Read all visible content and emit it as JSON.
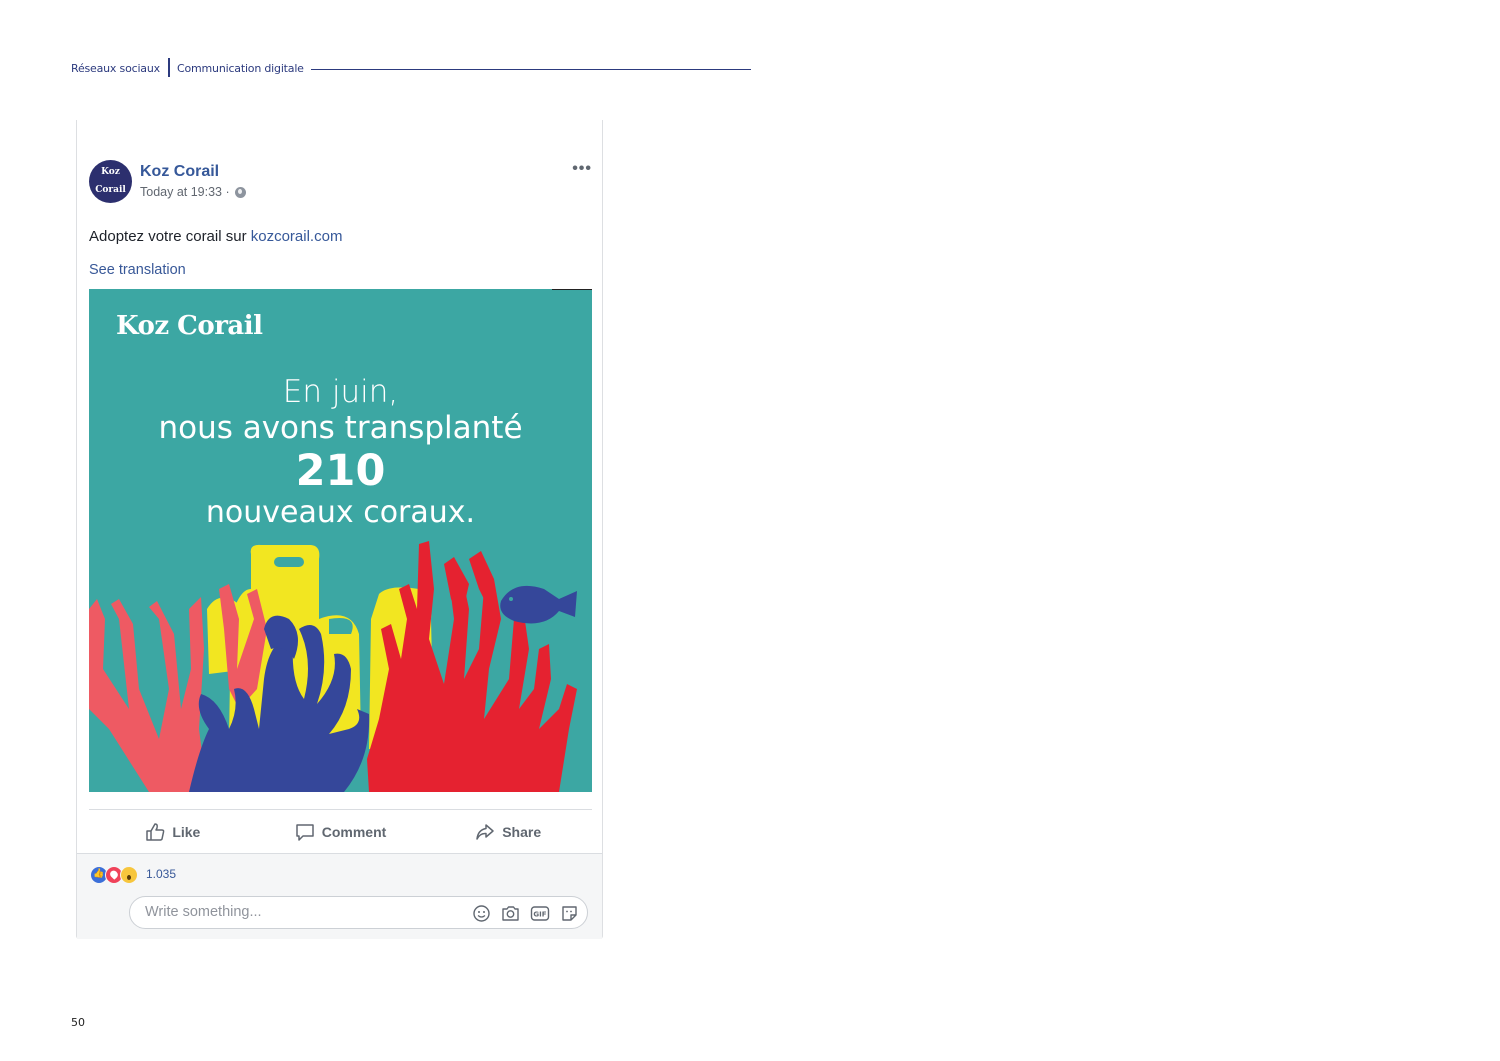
{
  "header": {
    "section": "Réseaux sociaux",
    "subsection": "Communication digitale"
  },
  "post": {
    "avatar_text_1": "Koz",
    "avatar_text_2": "Corail",
    "page_name": "Koz Corail",
    "timestamp": "Today at 19:33 ·",
    "text_prefix": "Adoptez votre corail sur ",
    "link": "kozcorail.com",
    "see_translation": "See translation",
    "image": {
      "brand": "Koz Corail",
      "line1": "En juin,",
      "line2": "nous avons transplanté",
      "number": "210",
      "line4": "nouveaux coraux.",
      "colors": {
        "background": "#3ca7a3",
        "coral_red": "#e52230",
        "coral_pink": "#ee5a63",
        "yellow": "#f2e621",
        "blue": "#35479a"
      }
    },
    "actions": {
      "like": "Like",
      "comment": "Comment",
      "share": "Share"
    },
    "reactions": {
      "types": [
        "like",
        "love",
        "wow"
      ],
      "count": "1.035"
    },
    "composer": {
      "placeholder": "Write something..."
    },
    "icons": [
      "more-icon",
      "globe-icon",
      "like-icon",
      "comment-icon",
      "share-icon",
      "emoji-icon",
      "camera-icon",
      "gif-icon",
      "sticker-icon"
    ]
  },
  "page_number": "50",
  "colors": {
    "brand_blue": "#2c3a7e",
    "fb_link": "#365899"
  }
}
